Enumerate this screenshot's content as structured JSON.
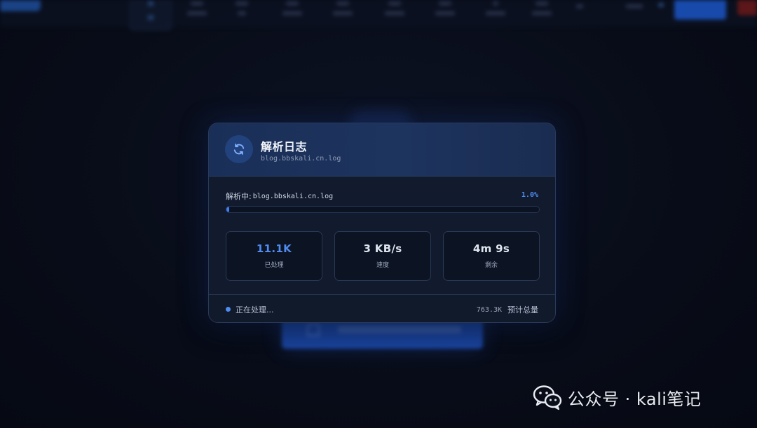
{
  "dialog": {
    "title": "解析日志",
    "subtitle": "blog.bbskali.cn.log",
    "icon": "refresh-icon"
  },
  "progress": {
    "label_prefix": "解析中:",
    "file": "blog.bbskali.cn.log",
    "percent_text": "1.0%",
    "value_percent": 1.0
  },
  "stats": [
    {
      "value": "11.1K",
      "label": "已处理"
    },
    {
      "value": "3 KB/s",
      "label": "速度"
    },
    {
      "value": "4m 9s",
      "label": "剩余"
    }
  ],
  "footer": {
    "status": "正在处理...",
    "total_value": "763.3K",
    "total_label": "预计总量"
  },
  "watermark": {
    "text": "公众号 · kali笔记",
    "icon": "wechat-icon"
  },
  "colors": {
    "accent": "#4f8bf0",
    "background": "#070b16",
    "dialog": "#121b2d",
    "header": "#1d345f"
  }
}
